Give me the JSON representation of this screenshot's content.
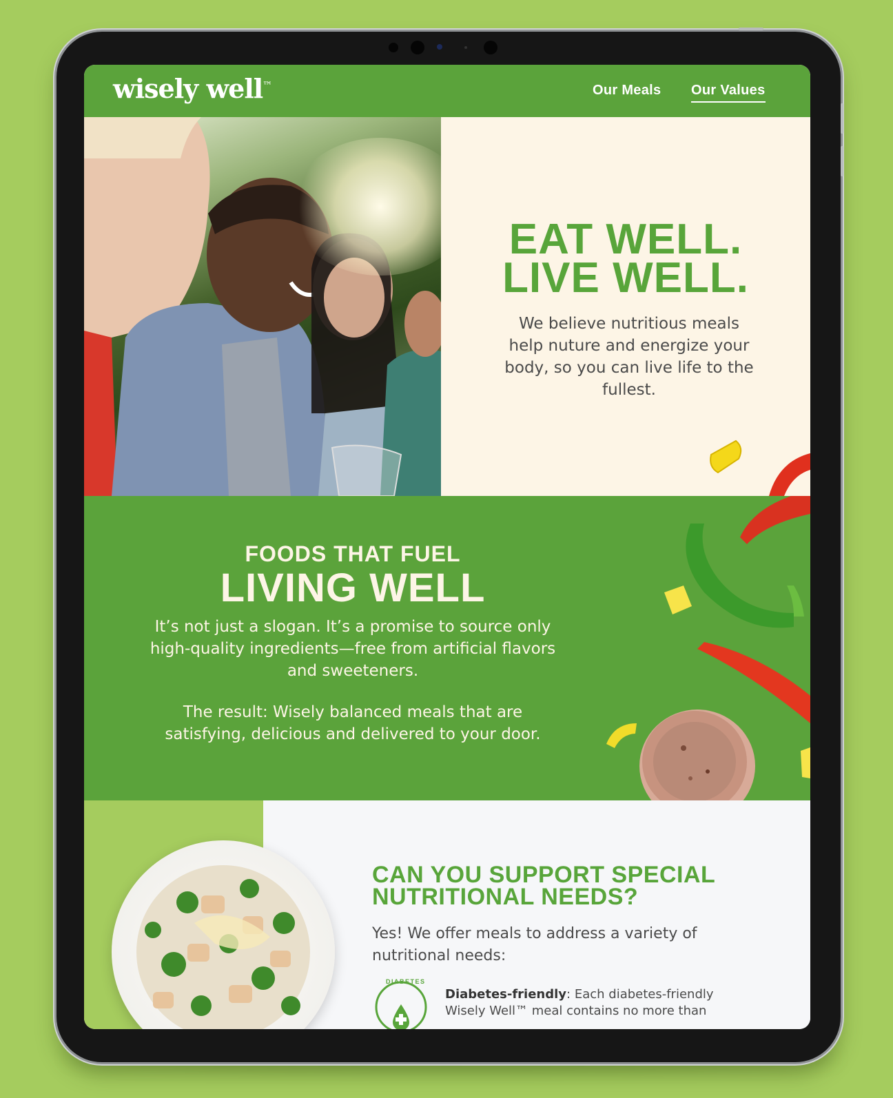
{
  "header": {
    "logo": "wisely well",
    "nav": [
      "Our Meals",
      "Our Values"
    ]
  },
  "hero": {
    "title_line1": "EAT WELL.",
    "title_line2": "LIVE WELL.",
    "text": "We believe nutritious meals help nuture and energize your body, so you can live life to the fullest."
  },
  "foods": {
    "kicker": "FOODS THAT FUEL",
    "title": "LIVING WELL",
    "paragraph1": "It’s not just a slogan. It’s a promise to source only high-quality ingredients—free from artificial flavors and sweeteners.",
    "paragraph2": "The result: Wisely balanced meals that are satisfying, delicious and delivered to your door."
  },
  "needs": {
    "title": "CAN YOU SUPPORT SPECIAL NUTRITIONAL NEEDS?",
    "intro": "Yes! We offer meals to address a variety of nutritional needs:",
    "badge_label": "DIABETES",
    "item_label": "Diabetes-friendly",
    "item_text": ": Each diabetes-friendly Wisely Well™ meal contains no more than"
  },
  "colors": {
    "brand_green": "#5ba33b",
    "light_green": "#a5cc5e",
    "cream": "#fdf5e6"
  }
}
